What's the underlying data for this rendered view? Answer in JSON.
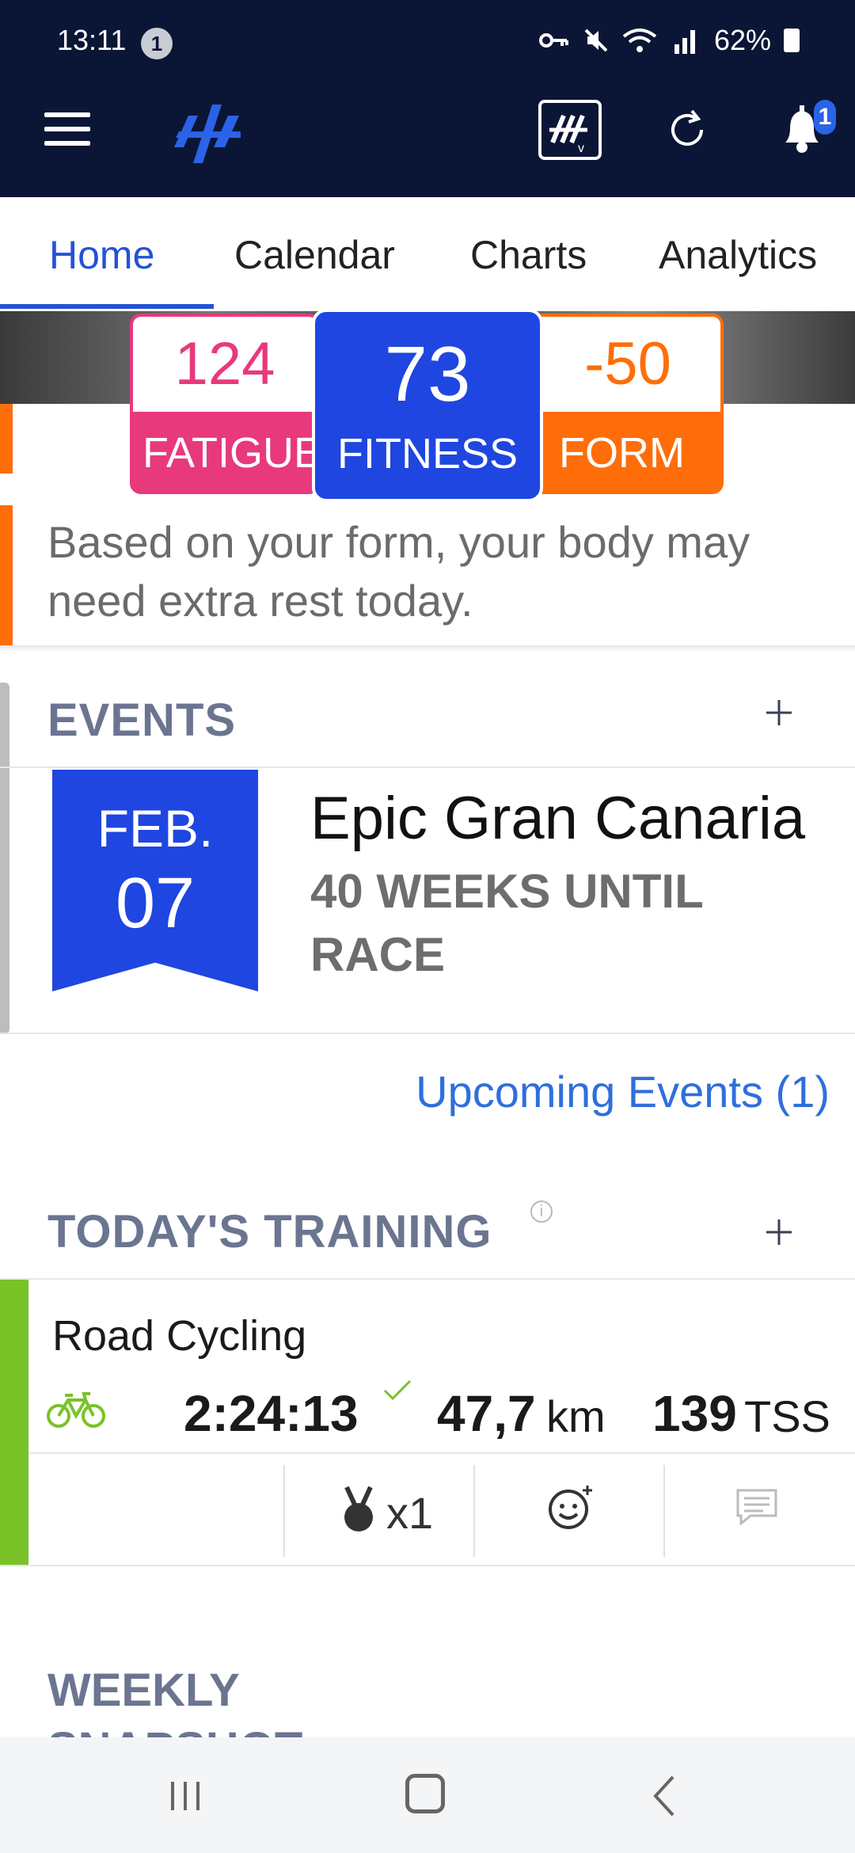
{
  "status_bar": {
    "time": "13:11",
    "notification_count": "1",
    "battery": "62%"
  },
  "app_bar": {
    "notification_badge": "1"
  },
  "tabs": [
    {
      "label": "Home",
      "active": true
    },
    {
      "label": "Calendar",
      "active": false
    },
    {
      "label": "Charts",
      "active": false
    },
    {
      "label": "Analytics",
      "active": false
    }
  ],
  "metrics": {
    "fatigue": {
      "value": "124",
      "label": "FATIGUE",
      "color": "#e8397d"
    },
    "fitness": {
      "value": "73",
      "label": "FITNESS",
      "color": "#1f46e0"
    },
    "form": {
      "value": "-50",
      "label": "FORM",
      "color": "#ff6d0a"
    },
    "message": "Based on your form, your body may need extra rest today."
  },
  "events": {
    "title": "EVENTS",
    "event": {
      "month": "FEB.",
      "day": "07",
      "name": "Epic Gran Canaria",
      "countdown": "40 WEEKS UNTIL RACE"
    },
    "upcoming_link": "Upcoming Events (1)"
  },
  "training": {
    "title": "TODAY'S TRAINING",
    "workout": {
      "name": "Road Cycling",
      "duration": "2:24:13",
      "distance": "47,7",
      "distance_unit": "km",
      "tss": "139",
      "tss_unit": "TSS",
      "medals": "x1",
      "accent_color": "#79c328"
    }
  },
  "weekly": {
    "title": "WEEKLY SNAPSHOT"
  }
}
